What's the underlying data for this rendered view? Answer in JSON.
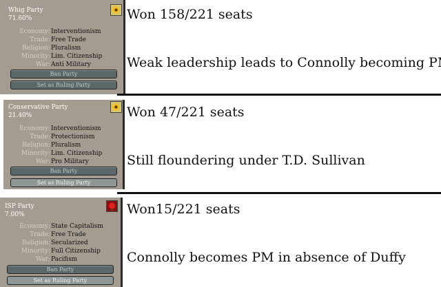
{
  "parties": [
    {
      "name": "Whig Party",
      "percent": "71.60%",
      "stats": [
        {
          "label": "Economy:",
          "value": "Interventionism"
        },
        {
          "label": "Trade:",
          "value": "Free Trade"
        },
        {
          "label": "Religion:",
          "value": "Pluralism"
        },
        {
          "label": "Minority:",
          "value": "Lim. Citizenship"
        },
        {
          "label": "War:",
          "value": "Anti Military"
        }
      ],
      "ban_label": "Ban Party",
      "rule_label": "Set as Ruling Party",
      "flag_icon": "sunflower-flag-icon",
      "flag_color": "#e0b420",
      "seats": "Won 158/221 seats",
      "note": "Weak leadership leads to Connolly becoming PM"
    },
    {
      "name": "Conservative Party",
      "percent": "21.40%",
      "stats": [
        {
          "label": "Economy:",
          "value": "Interventionism"
        },
        {
          "label": "Trade:",
          "value": "Protectionism"
        },
        {
          "label": "Religion:",
          "value": "Pluralism"
        },
        {
          "label": "Minority:",
          "value": "Lim. Citizenship"
        },
        {
          "label": "War:",
          "value": "Pro Military"
        }
      ],
      "ban_label": "Ban Party",
      "rule_label": "Set as Ruling Party",
      "flag_icon": "sunflower-flag-icon",
      "flag_color": "#e0b420",
      "seats": "Won 47/221 seats",
      "note": "Still floundering under T.D. Sullivan"
    },
    {
      "name": "ISP Party",
      "percent": "7.00%",
      "stats": [
        {
          "label": "Economy:",
          "value": "State Capitalism"
        },
        {
          "label": "Trade:",
          "value": "Free Trade"
        },
        {
          "label": "Religion:",
          "value": "Secularized"
        },
        {
          "label": "Minority:",
          "value": "Full Citizenship"
        },
        {
          "label": "War:",
          "value": "Pacifism"
        }
      ],
      "ban_label": "Ban Party",
      "rule_label": "Set as Ruling Party",
      "flag_icon": "rose-flag-icon",
      "flag_color": "#c81818",
      "seats": "Won15/221 seats",
      "note": "Connolly becomes PM in absence of Duffy"
    }
  ]
}
